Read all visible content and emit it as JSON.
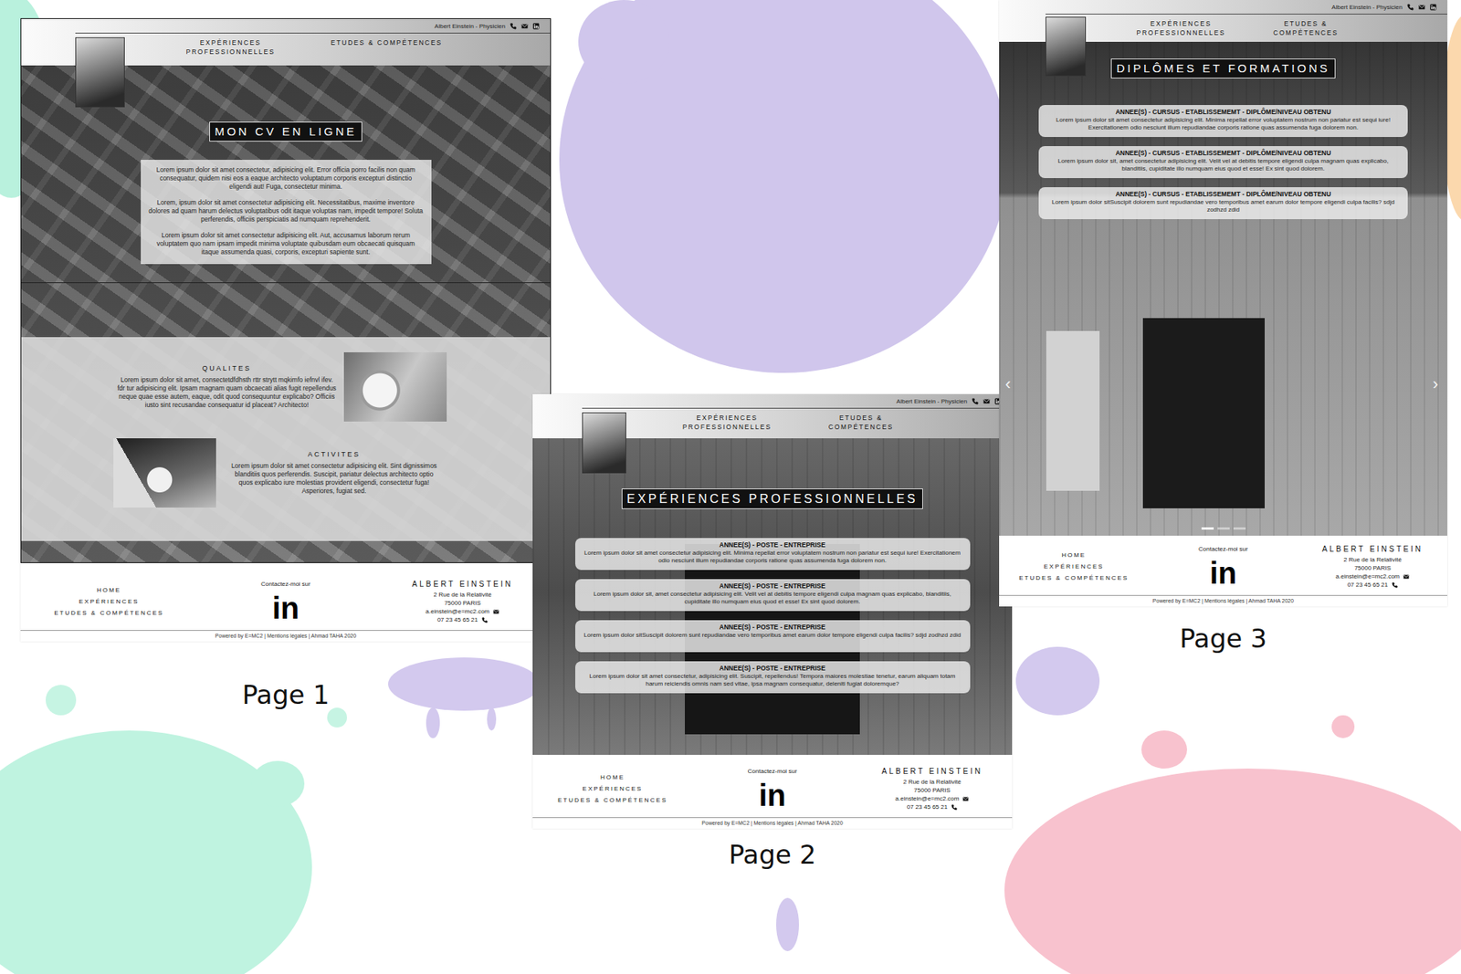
{
  "pages": [
    {
      "label": "Page 1",
      "kind": "home",
      "header": {
        "tagline": "Albert Einstein - Physicien",
        "nav": [
          "EXPÉRIENCES PROFESSIONNELLES",
          "ETUDES & COMPÉTENCES"
        ]
      },
      "title": "MON CV EN LIGNE",
      "paragraphs": [
        "Lorem ipsum dolor sit amet consectetur, adipisicing elit. Error officia porro facilis non quam consequatur, quidem nisi eos a eaque architecto voluptatum corporis excepturi distinctio eligendi aut! Fuga, consectetur minima.",
        "Lorem, ipsum dolor sit amet consectetur adipisicing elit. Necessitatibus, maxime inventore dolores ad quam harum delectus voluptatibus odit itaque voluptas nam, impedit tempore! Soluta perferendis, officiis perspiciatis ad numquam reprehenderit.",
        "Lorem ipsum dolor sit amet consectetur adipisicing elit. Aut, accusamus laborum rerum voluptatem quo nam ipsam impedit minima voluptate quibusdam eum obcaecati quisquam itaque assumenda quasi, corporis, excepturi sapiente sunt."
      ],
      "sections": [
        {
          "heading": "QUALITES",
          "text": "Lorem ipsum dolor sit amet, consectetdfdhsth rttr strytt mqkimfo iefnvl ifev. fdr tur adipisicing elit. Ipsam magnam quam obcaecati alias fugit repellendus neque quae esse autem, eaque, odit quod consequuntur explicabo? Officiis iusto sint recusandae consequatur id placeat? Architecto!"
        },
        {
          "heading": "ACTIVITES",
          "text": "Lorem ipsum dolor sit amet consectetur adipisicing elit. Sint dignissimos blanditiis quos perferendis. Suscipit, pariatur delectus architecto optio quos explicabo iure molestias provident eligendi, consectetur fuga! Asperiores, fugiat sed."
        }
      ],
      "footer": {
        "nav": [
          "HOME",
          "EXPÉRIENCES",
          "ETUDES & COMPÉTENCES"
        ],
        "contact_label": "Contactez-moi sur",
        "linkedin": "in",
        "name": "ALBERT EINSTEIN",
        "address": [
          "2 Rue de la Relativité",
          "75000 PARIS"
        ],
        "email": "a.einstein@e=mc2.com",
        "phone": "07 23 45 65 21",
        "credits": "Powered by E=MC2 | Mentions légales | Ahmad TAHA 2020"
      }
    },
    {
      "label": "Page 2",
      "kind": "experience",
      "header": {
        "tagline": "Albert Einstein - Physicien",
        "nav": [
          "EXPÉRIENCES PROFESSIONNELLES",
          "ETUDES & COMPÉTENCES"
        ]
      },
      "title": "EXPÉRIENCES PROFESSIONNELLES",
      "cards": [
        {
          "heading": "ANNEE(S) - POSTE - ENTREPRISE",
          "text": "Lorem ipsum dolor sit amet consectetur adipisicing elit. Minima repellat error voluptatem nostrum non pariatur est sequi iure! Exercitationem odio nesciunt illum repudiandae corporis ratione quas assumenda fuga dolorem non."
        },
        {
          "heading": "ANNEE(S) - POSTE - ENTREPRISE",
          "text": "Lorem ipsum dolor sit, amet consectetur adipisicing elit. Velit vel at debitis tempore eligendi culpa magnam quas explicabo, blanditiis, cupiditate illo numquam eius quod et esse! Ex sint quod dolorem."
        },
        {
          "heading": "ANNEE(S) - POSTE - ENTREPRISE",
          "text": "Lorem ipsum dolor sitSuscipit dolorem sunt repudiandae vero temporibus amet earum dolor tempore eligendi culpa facilis? sdjd zodhzd zdid"
        },
        {
          "heading": "ANNEE(S) - POSTE - ENTREPRISE",
          "text": "Lorem ipsum dolor sit amet consectetur, adipisicing elit. Suscipit, repellendus! Tempora maiores molestiae tenetur, earum aliquam totam harum reiciendis omnis nam sed vitae, ipsa magnam consequatur, deleniti fugiat doloremque?"
        }
      ],
      "footer": {
        "nav": [
          "HOME",
          "EXPÉRIENCES",
          "ETUDES & COMPÉTENCES"
        ],
        "contact_label": "Contactez-moi sur",
        "linkedin": "in",
        "name": "ALBERT EINSTEIN",
        "address": [
          "2 Rue de la Relativité",
          "75000 PARIS"
        ],
        "email": "a.einstein@e=mc2.com",
        "phone": "07 23 45 65 21",
        "credits": "Powered by E=MC2 | Mentions légales | Ahmad TAHA 2020"
      }
    },
    {
      "label": "Page 3",
      "kind": "education",
      "header": {
        "tagline": "Albert Einstein - Physicien",
        "nav": [
          "EXPÉRIENCES PROFESSIONNELLES",
          "ETUDES & COMPÉTENCES"
        ]
      },
      "title": "DIPLÔMES ET FORMATIONS",
      "cards": [
        {
          "heading": "ANNEE(S) - CURSUS - ETABLISSEMEMT - DIPLÔME/NIVEAU OBTENU",
          "text": "Lorem ipsum dolor sit amet consectetur adipisicing elit. Minima repellat error voluptatem nostrum non pariatur est sequi iure! Exercitationem odio nesciunt illum repudiandae corporis ratione quas assumenda fuga dolorem non."
        },
        {
          "heading": "ANNEE(S) - CURSUS - ETABLISSEMEMT - DIPLÔME/NIVEAU OBTENU",
          "text": "Lorem ipsum dolor sit, amet consectetur adipisicing elit. Velit vel at debitis tempore eligendi culpa magnam quas explicabo, blanditiis, cupiditate illo numquam eius quod et esse! Ex sint quod dolorem."
        },
        {
          "heading": "ANNEE(S) - CURSUS - ETABLISSEMEMT - DIPLÔME/NIVEAU OBTENU",
          "text": "Lorem ipsum dolor sitSuscipit dolorem sunt repudiandae vero temporibus amet earum dolor tempore eligendi culpa facilis? sdjd zodhzd zdid"
        }
      ],
      "carousel": {
        "prev": "‹",
        "next": "›",
        "slides": [
          {
            "selected": true
          },
          {
            "selected": false
          },
          {
            "selected": false
          }
        ]
      },
      "footer": {
        "nav": [
          "HOME",
          "EXPÉRIENCES",
          "ETUDES & COMPÉTENCES"
        ],
        "contact_label": "Contactez-moi sur",
        "linkedin": "in",
        "name": "ALBERT EINSTEIN",
        "address": [
          "2 Rue de la Relativité",
          "75000 PARIS"
        ],
        "email": "a.einstein@e=mc2.com",
        "phone": "07 23 45 65 21",
        "credits": "Powered by E=MC2 | Mentions légales | Ahmad TAHA 2020"
      }
    }
  ]
}
